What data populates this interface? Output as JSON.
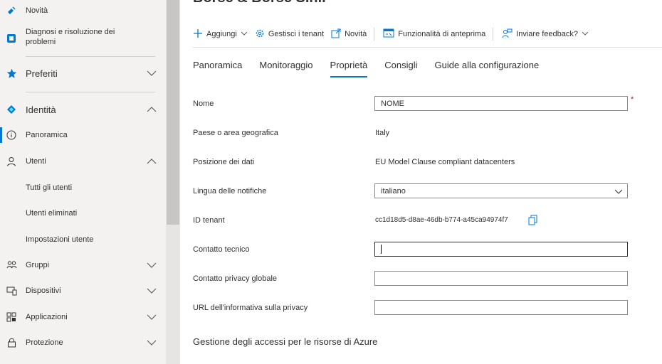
{
  "sidebar": {
    "items": [
      {
        "label": "Novità"
      },
      {
        "label": "Diagnosi e risoluzione dei problemi"
      },
      {
        "label": "Preferiti"
      },
      {
        "label": "Identità"
      },
      {
        "label": "Panoramica"
      },
      {
        "label": "Utenti"
      },
      {
        "label": "Tutti gli utenti"
      },
      {
        "label": "Utenti eliminati"
      },
      {
        "label": "Impostazioni utente"
      },
      {
        "label": "Gruppi"
      },
      {
        "label": "Dispositivi"
      },
      {
        "label": "Applicazioni"
      },
      {
        "label": "Protezione"
      }
    ]
  },
  "header": {
    "title": "Borse & Borse S.r.l."
  },
  "toolbar": {
    "add_label": "Aggiungi",
    "manage_tenants_label": "Gestisci i tenant",
    "whats_new_label": "Novità",
    "preview_features_label": "Funzionalità di anteprima",
    "feedback_label": "Inviare feedback?"
  },
  "tabs": [
    {
      "label": "Panoramica"
    },
    {
      "label": "Monitoraggio"
    },
    {
      "label": "Proprietà"
    },
    {
      "label": "Consigli"
    },
    {
      "label": "Guide alla configurazione"
    }
  ],
  "properties": {
    "name": {
      "label": "Nome",
      "value": "NOME",
      "required_mark": "*"
    },
    "country": {
      "label": "Paese o area geografica",
      "value": "Italy"
    },
    "data_location": {
      "label": "Posizione dei dati",
      "value": "EU Model Clause compliant datacenters"
    },
    "notification_language": {
      "label": "Lingua delle notifiche",
      "value": "italiano"
    },
    "tenant_id": {
      "label": "ID tenant",
      "value": "cc1d18d5-d8ae-46db-b774-a45ca94974f7"
    },
    "technical_contact": {
      "label": "Contatto tecnico",
      "value": ""
    },
    "global_privacy_contact": {
      "label": "Contatto privacy globale",
      "value": ""
    },
    "privacy_url": {
      "label": "URL dell'informativa sulla privacy",
      "value": ""
    }
  },
  "section_heading": "Gestione degli accessi per le risorse di Azure",
  "colors": {
    "accent": "#0078d4",
    "sidebar_bg": "#f3f2f1",
    "required": "#a4262c"
  }
}
